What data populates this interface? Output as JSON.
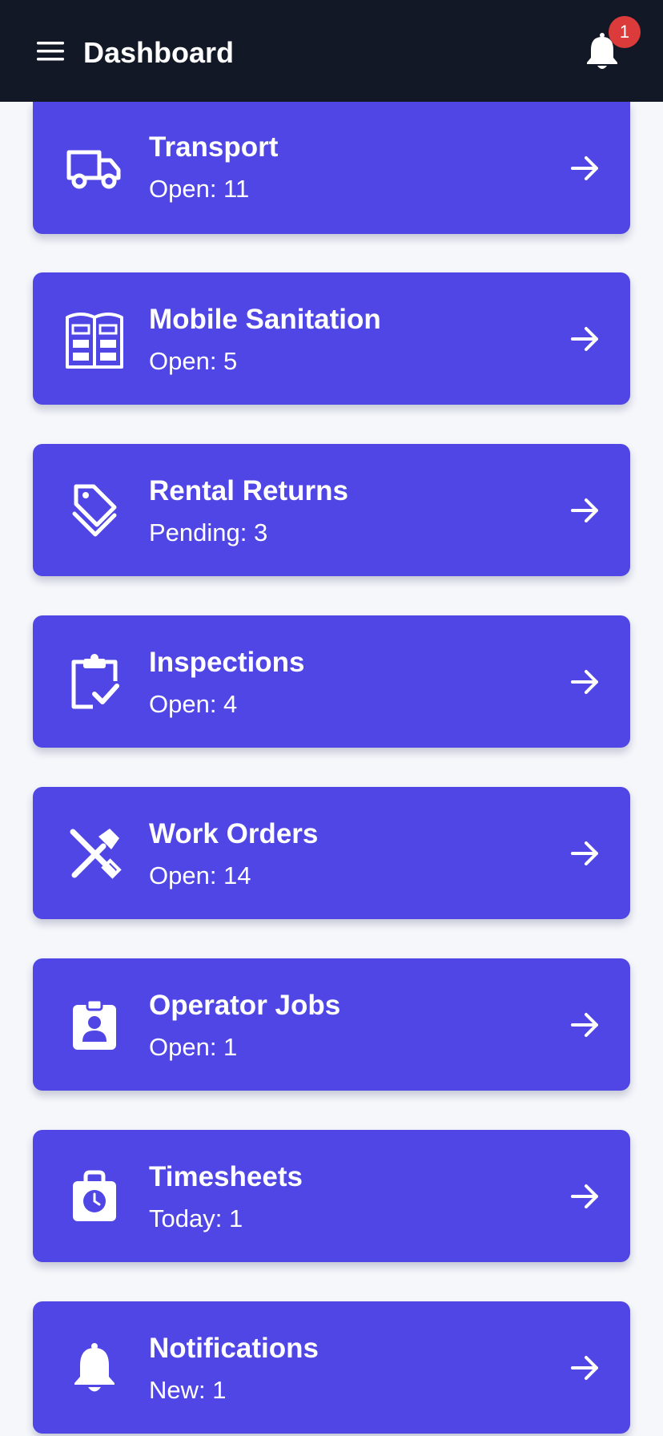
{
  "header": {
    "title": "Dashboard",
    "notification_count": "1"
  },
  "colors": {
    "header_bg": "#121826",
    "card_bg": "#4f46e5",
    "badge_bg": "#dc3b3b",
    "page_bg": "#f5f7fb"
  },
  "cards": [
    {
      "title": "Transport",
      "subtitle": "Open: 11",
      "icon": "truck-icon"
    },
    {
      "title": "Mobile Sanitation",
      "subtitle": "Open: 5",
      "icon": "portable-toilet-icon"
    },
    {
      "title": "Rental Returns",
      "subtitle": "Pending: 3",
      "icon": "tags-icon"
    },
    {
      "title": "Inspections",
      "subtitle": "Open: 4",
      "icon": "clipboard-check-icon"
    },
    {
      "title": "Work Orders",
      "subtitle": "Open: 14",
      "icon": "tools-icon"
    },
    {
      "title": "Operator Jobs",
      "subtitle": "Open: 1",
      "icon": "id-badge-icon"
    },
    {
      "title": "Timesheets",
      "subtitle": "Today: 1",
      "icon": "clock-bag-icon"
    },
    {
      "title": "Notifications",
      "subtitle": "New: 1",
      "icon": "bell-icon"
    }
  ]
}
